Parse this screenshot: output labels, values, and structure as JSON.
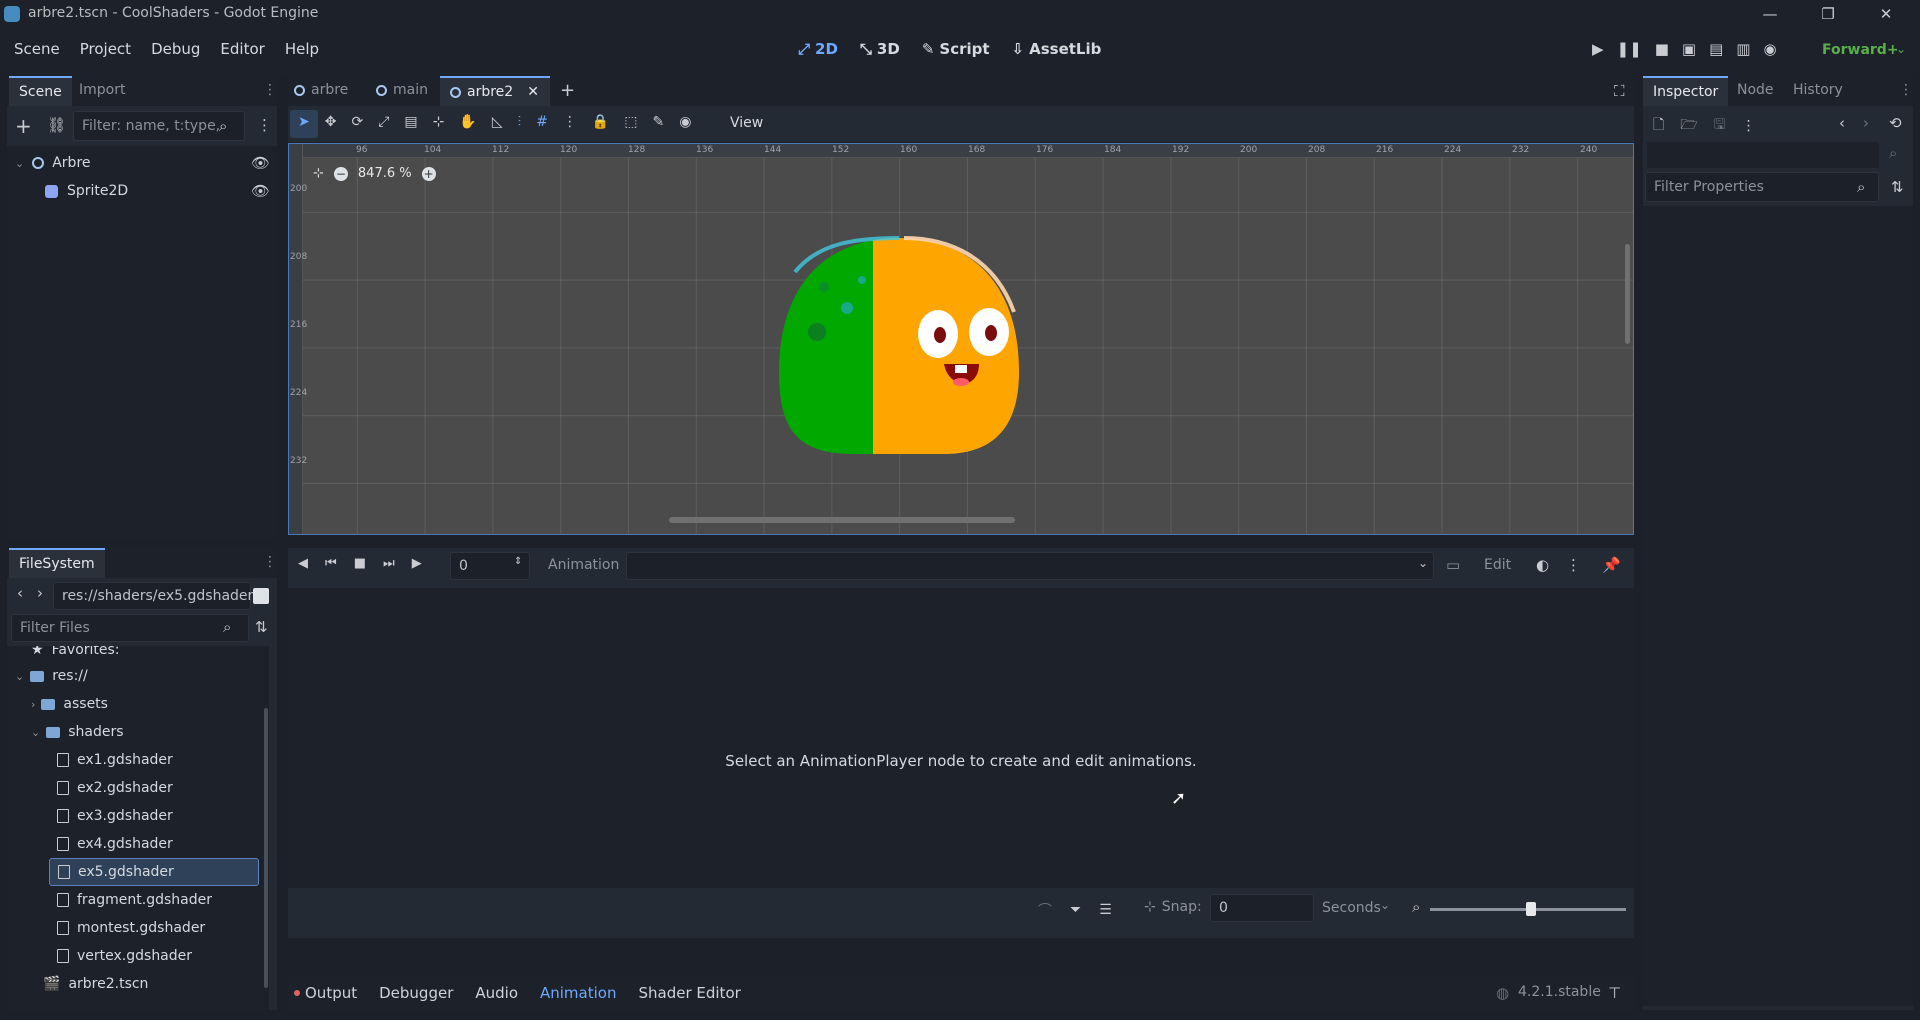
{
  "window": {
    "title": "arbre2.tscn - CoolShaders - Godot Engine",
    "controls": [
      "—",
      "❐",
      "✕"
    ]
  },
  "menu": {
    "items": [
      "Scene",
      "Project",
      "Debug",
      "Editor",
      "Help"
    ]
  },
  "workspaces": {
    "items": [
      "2D",
      "3D",
      "Script",
      "AssetLib"
    ],
    "active": "2D"
  },
  "renderer": "Forward+",
  "scene_dock": {
    "tabs": [
      "Scene",
      "Import"
    ],
    "filter_placeholder": "Filter: name, t:type,",
    "tree": [
      {
        "label": "Arbre"
      },
      {
        "label": "Sprite2D"
      }
    ]
  },
  "editor_tabs": [
    "arbre",
    "main",
    "arbre2"
  ],
  "toolbar": {
    "view_label": "View"
  },
  "viewport": {
    "zoom": "847.6 %",
    "ruler_ticks": [
      "96",
      "104",
      "112",
      "120",
      "128",
      "136",
      "144",
      "152",
      "160",
      "168",
      "176",
      "184",
      "192",
      "200",
      "208",
      "216",
      "224",
      "232",
      "240"
    ],
    "ruler_v_ticks": [
      "200",
      "208",
      "216",
      "224",
      "232"
    ]
  },
  "filesystem": {
    "tab": "FileSystem",
    "path": "res://shaders/ex5.gdshader",
    "filter_placeholder": "Filter Files",
    "items": [
      {
        "label": "Favorites:"
      },
      {
        "label": "res://"
      },
      {
        "label": "assets"
      },
      {
        "label": "shaders"
      },
      {
        "label": "ex1.gdshader"
      },
      {
        "label": "ex2.gdshader"
      },
      {
        "label": "ex3.gdshader"
      },
      {
        "label": "ex4.gdshader"
      },
      {
        "label": "ex5.gdshader"
      },
      {
        "label": "fragment.gdshader"
      },
      {
        "label": "montest.gdshader"
      },
      {
        "label": "vertex.gdshader"
      },
      {
        "label": "arbre2.tscn"
      }
    ],
    "selected": "ex5.gdshader"
  },
  "animation": {
    "time_value": "0",
    "animation_label": "Animation",
    "edit_label": "Edit",
    "empty_message": "Select an AnimationPlayer node to create and edit animations.",
    "snap_label": "Snap:",
    "snap_value": "0",
    "unit": "Seconds"
  },
  "bottom_tabs": [
    "Output",
    "Debugger",
    "Audio",
    "Animation",
    "Shader Editor"
  ],
  "active_bottom_tab": "Animation",
  "version": "4.2.1.stable",
  "inspector": {
    "tabs": [
      "Inspector",
      "Node",
      "History"
    ],
    "filter_placeholder": "Filter Properties"
  },
  "colors": {
    "accent": "#6ea8ff",
    "bg": "#1d2129",
    "panel": "#242a33",
    "selected": "#2f4159",
    "renderer": "#59b04a"
  }
}
